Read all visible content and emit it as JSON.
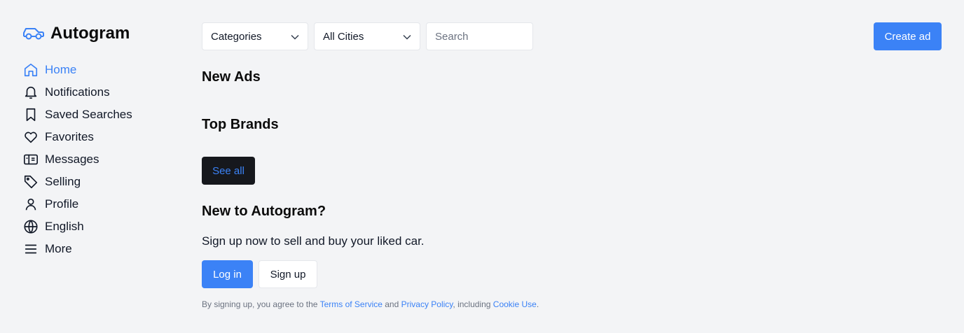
{
  "brand": {
    "name": "Autogram",
    "icon": "car-icon",
    "accent": "#3b82f6"
  },
  "sidebar": {
    "items": [
      {
        "label": "Home",
        "icon": "home-icon",
        "active": true
      },
      {
        "label": "Notifications",
        "icon": "bell-icon"
      },
      {
        "label": "Saved Searches",
        "icon": "bookmark-icon"
      },
      {
        "label": "Favorites",
        "icon": "heart-icon"
      },
      {
        "label": "Messages",
        "icon": "inbox-icon"
      },
      {
        "label": "Selling",
        "icon": "tag-icon"
      },
      {
        "label": "Profile",
        "icon": "user-icon"
      },
      {
        "label": "English",
        "icon": "globe-icon"
      },
      {
        "label": "More",
        "icon": "menu-icon"
      }
    ]
  },
  "topbar": {
    "categories": "Categories",
    "cities": "All Cities",
    "search_placeholder": "Search",
    "create_label": "Create ad"
  },
  "main": {
    "new_ads_title": "New Ads",
    "top_brands_title": "Top Brands",
    "see_all_label": "See all",
    "join_title": "New to Autogram?",
    "join_text": "Sign up now to sell and buy your liked car.",
    "login_label": "Log in",
    "signup_label": "Sign up",
    "legal": {
      "prefix": "By signing up, you agree to the ",
      "terms": "Terms of Service",
      "and": " and ",
      "privacy": "Privacy Policy",
      "including": ", including ",
      "cookie": "Cookie Use",
      "suffix": "."
    }
  }
}
